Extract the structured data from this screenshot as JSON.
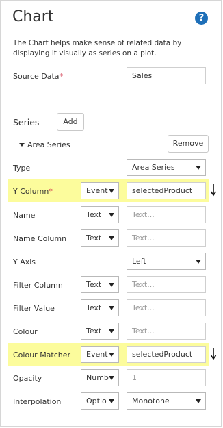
{
  "panel": {
    "title": "Chart",
    "help_icon": "?",
    "description": "The Chart helps make sense of related data by displaying it visually as series on a plot."
  },
  "source_data": {
    "label": "Source Data",
    "required_mark": "*",
    "value": "Sales"
  },
  "series": {
    "label": "Series",
    "add_label": "Add",
    "area_series_label": "Area Series",
    "remove_label": "Remove"
  },
  "fields": {
    "type": {
      "label": "Type",
      "value": "Area Series"
    },
    "y_column": {
      "label": "Y Column",
      "required_mark": "*",
      "mode": "Event",
      "value": "selectedProduct"
    },
    "name": {
      "label": "Name",
      "mode": "Text",
      "placeholder": "Text..."
    },
    "name_column": {
      "label": "Name Column",
      "mode": "Text",
      "placeholder": "Text..."
    },
    "y_axis": {
      "label": "Y Axis",
      "value": "Left"
    },
    "filter_column": {
      "label": "Filter Column",
      "mode": "Text",
      "placeholder": "Text..."
    },
    "filter_value": {
      "label": "Filter Value",
      "mode": "Text",
      "placeholder": "Text..."
    },
    "colour": {
      "label": "Colour",
      "mode": "Text",
      "placeholder": "Text..."
    },
    "colour_matcher": {
      "label": "Colour Matcher",
      "mode": "Event",
      "value": "selectedProduct"
    },
    "opacity": {
      "label": "Opacity",
      "mode": "Numb",
      "value": "1"
    },
    "interpolation": {
      "label": "Interpolation",
      "mode": "Optio",
      "value": "Monotone"
    }
  },
  "colors": {
    "highlight": "#fcfc9c",
    "required": "#d2374c",
    "help": "#1e6fb8"
  },
  "icons": {
    "help": "help-icon",
    "arrow": "arrow-down-icon",
    "caret": "caret-down-icon",
    "triangle": "triangle-down-icon"
  }
}
